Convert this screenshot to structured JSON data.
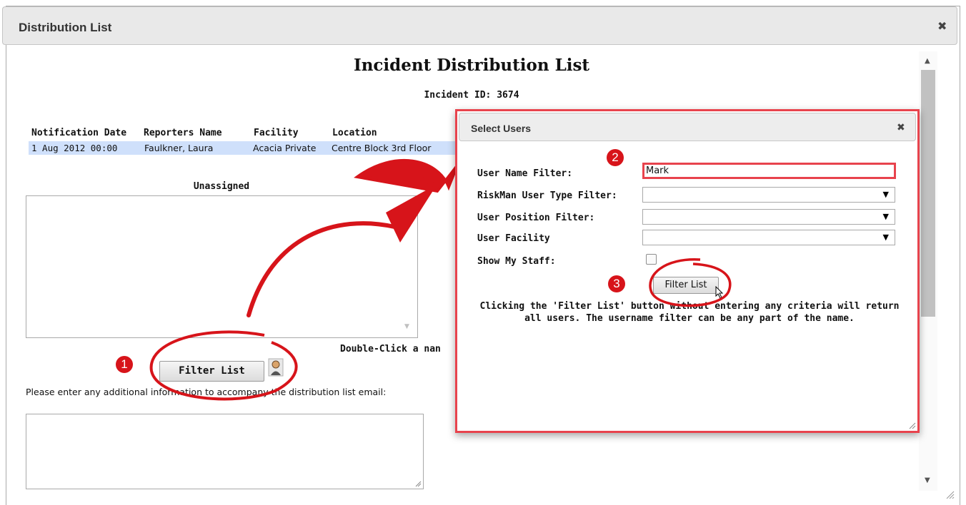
{
  "window": {
    "title": "Distribution List",
    "close_glyph": "✖"
  },
  "page": {
    "heading": "Incident Distribution List",
    "incident_id": "Incident ID: 3674",
    "table": {
      "headers": [
        "Notification Date",
        "Reporters Name",
        "Facility",
        "Location"
      ],
      "row": [
        "1 Aug 2012 00:00",
        "Faulkner, Laura",
        "Acacia Private",
        "Centre Block 3rd Floor"
      ]
    },
    "unassigned_label": "Unassigned",
    "double_click_hint": "Double-Click a nan",
    "filter_button": "Filter List",
    "info_prompt": "Please enter any additional information to accompany the distribution list email:"
  },
  "select_users": {
    "title": "Select Users",
    "close_glyph": "✖",
    "user_name_label": "User Name Filter:",
    "user_name_value": "Mark",
    "user_type_label": "RiskMan User Type Filter:",
    "user_position_label": "User Position Filter:",
    "user_facility_label": "User Facility",
    "show_staff_label": "Show My Staff:",
    "filter_button": "Filter List",
    "hint": "Clicking the 'Filter List' button without entering any criteria will return all users. The username filter can be any part of the name."
  },
  "annotations": {
    "step1": "1",
    "step2": "2",
    "step3": "3",
    "color": "#d7141a"
  },
  "icons": [
    "close-icon",
    "person-icon",
    "dropdown-arrow-icon",
    "scroll-up-icon",
    "scroll-down-icon",
    "resize-grip-icon",
    "mouse-cursor-icon"
  ]
}
